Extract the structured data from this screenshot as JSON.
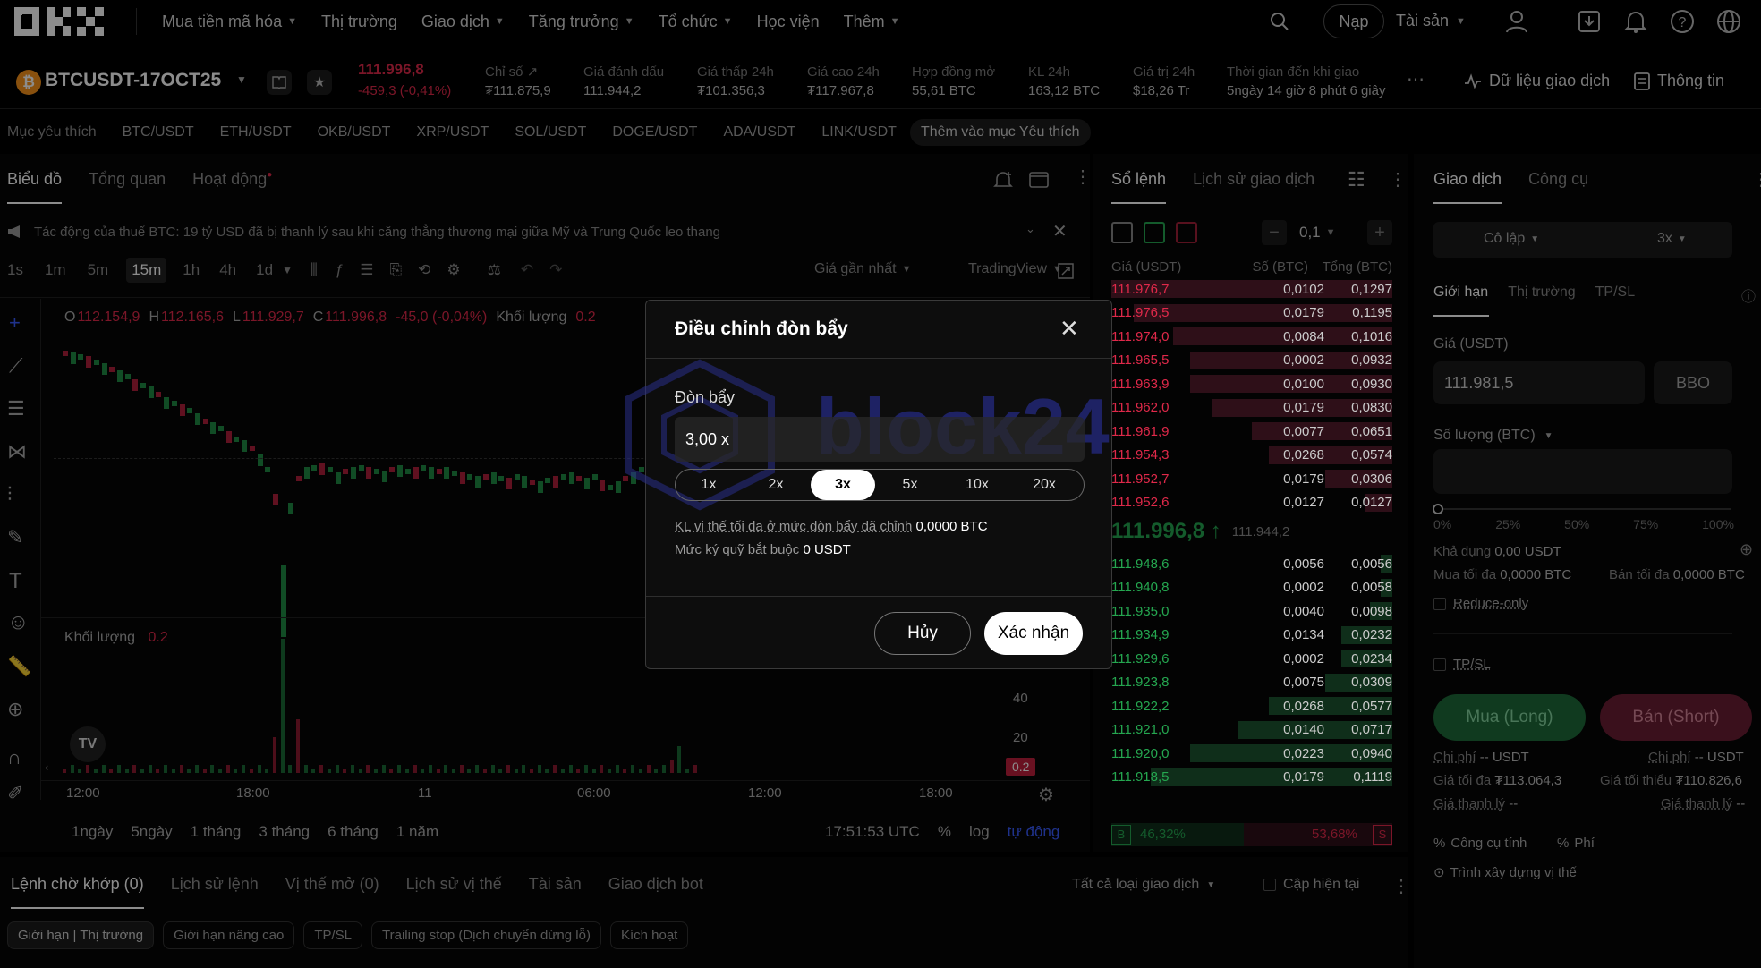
{
  "nav": {
    "items": [
      "Mua tiền mã hóa",
      "Thị trường",
      "Giao dịch",
      "Tăng trưởng",
      "Tổ chức",
      "Học viện",
      "Thêm"
    ],
    "deposit": "Nạp",
    "assets": "Tài sản"
  },
  "ticker": {
    "symbol": "BTCUSDT-17OCT25",
    "last_price": "111.996,8",
    "change": "-459,3 (-0,41%)",
    "stats": [
      {
        "label": "Chỉ số",
        "value": "₮111.875,9"
      },
      {
        "label": "Giá đánh dấu",
        "value": "111.944,2"
      },
      {
        "label": "Giá thấp 24h",
        "value": "₮101.356,3"
      },
      {
        "label": "Giá cao 24h",
        "value": "₮117.967,8"
      },
      {
        "label": "Hợp đồng mở",
        "value": "55,61 BTC"
      },
      {
        "label": "KL 24h",
        "value": "163,12 BTC"
      },
      {
        "label": "Giá trị 24h",
        "value": "$18,26 Tr"
      },
      {
        "label": "Thời gian đến khi giao",
        "value": "5ngày 14 giờ 8 phút 6 giây"
      }
    ],
    "market_data": "Dữ liệu giao dịch",
    "info": "Thông tin"
  },
  "favorites": {
    "label": "Mục yêu thích",
    "pairs": [
      "BTC/USDT",
      "ETH/USDT",
      "OKB/USDT",
      "XRP/USDT",
      "SOL/USDT",
      "DOGE/USDT",
      "ADA/USDT",
      "LINK/USDT"
    ],
    "add": "Thêm vào mục Yêu thích"
  },
  "chart": {
    "tabs": [
      "Biểu đồ",
      "Tổng quan",
      "Hoạt động"
    ],
    "news": "Tác động của thuế BTC: 19 tỷ USD đã bị thanh lý sau khi căng thẳng thương mại giữa Mỹ và Trung Quốc leo thang",
    "intervals": [
      "1s",
      "1m",
      "5m",
      "15m",
      "1h",
      "4h",
      "1d"
    ],
    "active_interval": "15m",
    "price_type": "Giá gần nhất",
    "view": "TradingView",
    "ohlc": {
      "o_label": "O",
      "o": "112.154,9",
      "h_label": "H",
      "h": "112.165,6",
      "l_label": "L",
      "l": "111.929,7",
      "c_label": "C",
      "c": "111.996,8",
      "chg": "-45,0 (-0,04%)",
      "vol_label": "Khối lượng",
      "vol": "0.2"
    },
    "volume_label": "Khối lượng",
    "volume_value": "0.2",
    "vol_axis": [
      "40",
      "20"
    ],
    "vol_tag": "0.2",
    "time_axis": [
      "12:00",
      "18:00",
      "11",
      "06:00",
      "12:00",
      "18:00"
    ],
    "ranges": [
      "1ngày",
      "5ngày",
      "1 tháng",
      "3 tháng",
      "6 tháng",
      "1 năm"
    ],
    "clock": "17:51:53 UTC",
    "scale_pct": "%",
    "scale_log": "log",
    "scale_auto": "tự động"
  },
  "orderbook": {
    "tabs": [
      "Sổ lệnh",
      "Lịch sử giao dịch"
    ],
    "step": "0,1",
    "headers": [
      "Giá (USDT)",
      "Số (BTC)",
      "Tổng (BTC)"
    ],
    "asks": [
      [
        "111.976,7",
        "0,0102",
        "0,1297"
      ],
      [
        "111.976,5",
        "0,0179",
        "0,1195"
      ],
      [
        "111.974,0",
        "0,0084",
        "0,1016"
      ],
      [
        "111.965,5",
        "0,0002",
        "0,0932"
      ],
      [
        "111.963,9",
        "0,0100",
        "0,0930"
      ],
      [
        "111.962,0",
        "0,0179",
        "0,0830"
      ],
      [
        "111.961,9",
        "0,0077",
        "0,0651"
      ],
      [
        "111.954,3",
        "0,0268",
        "0,0574"
      ],
      [
        "111.952,7",
        "0,0179",
        "0,0306"
      ],
      [
        "111.952,6",
        "0,0127",
        "0,0127"
      ]
    ],
    "mid_price": "111.996,8 ↑",
    "mid_mark": "111.944,2",
    "bids": [
      [
        "111.948,6",
        "0,0056",
        "0,0056"
      ],
      [
        "111.940,8",
        "0,0002",
        "0,0058"
      ],
      [
        "111.935,0",
        "0,0040",
        "0,0098"
      ],
      [
        "111.934,9",
        "0,0134",
        "0,0232"
      ],
      [
        "111.929,6",
        "0,0002",
        "0,0234"
      ],
      [
        "111.923,8",
        "0,0075",
        "0,0309"
      ],
      [
        "111.922,2",
        "0,0268",
        "0,0577"
      ],
      [
        "111.921,0",
        "0,0140",
        "0,0717"
      ],
      [
        "111.920,0",
        "0,0223",
        "0,0940"
      ],
      [
        "111.918,5",
        "0,0179",
        "0,1119"
      ]
    ],
    "buy_tag": "B",
    "buy_pct": "46,32%",
    "sell_pct": "53,68%",
    "sell_tag": "S"
  },
  "trade": {
    "tabs": [
      "Giao dịch",
      "Công cụ"
    ],
    "margin_mode": "Cô lập",
    "leverage": "3x",
    "order_tabs": [
      "Giới hạn",
      "Thị trường",
      "TP/SL"
    ],
    "price_label": "Giá (USDT)",
    "price_value": "111.981,5",
    "bbo": "BBO",
    "qty_label": "Số lượng (BTC)",
    "slider_marks": [
      "0%",
      "25%",
      "50%",
      "75%",
      "100%"
    ],
    "available_label": "Khả dụng",
    "available": "0,00 USDT",
    "max_buy_label": "Mua tối đa",
    "max_buy": "0,0000 BTC",
    "max_sell_label": "Bán tối đa",
    "max_sell": "0,0000 BTC",
    "reduce_only": "Reduce-only",
    "tpsl": "TP/SL",
    "buy": "Mua (Long)",
    "sell": "Bán (Short)",
    "cost_label": "Chi phí",
    "cost_value": "-- USDT",
    "max_price_label": "Giá tối đa",
    "max_price": "₮113.064,3",
    "min_price_label": "Giá tối thiểu",
    "min_price": "₮110.826,6",
    "liq_label": "Giá thanh lý",
    "liq_value": "--",
    "calc": "Công cụ tính",
    "fee": "Phí",
    "builder": "Trình xây dựng vị thế"
  },
  "bottom": {
    "tabs": [
      "Lệnh chờ khớp (0)",
      "Lịch sử lệnh",
      "Vị thế mở (0)",
      "Lịch sử vị thế",
      "Tài sản",
      "Giao dịch bot"
    ],
    "filter": "Tất cả loại giao dịch",
    "current_only": "Cập hiện tại",
    "pills": [
      "Giới hạn | Thị trường",
      "Giới hạn nâng cao",
      "TP/SL",
      "Trailing stop (Dịch chuyển dừng lỗ)",
      "Kích hoạt"
    ]
  },
  "modal": {
    "title": "Điều chỉnh đòn bẩy",
    "field_label": "Đòn bẩy",
    "value": "3,00 x",
    "options": [
      "1x",
      "2x",
      "3x",
      "5x",
      "10x",
      "20x"
    ],
    "selected": "3x",
    "max_pos_label": "KL vị thế tối đa ở mức đòn bẩy đã chỉnh",
    "max_pos_value": "0,0000 BTC",
    "margin_label": "Mức ký quỹ bắt buộc",
    "margin_value": "0 USDT",
    "cancel": "Hủy",
    "confirm": "Xác nhận",
    "watermark": "block24"
  }
}
